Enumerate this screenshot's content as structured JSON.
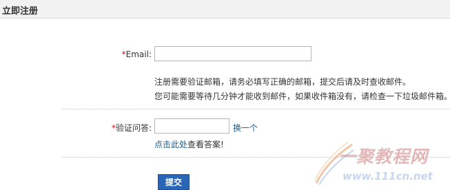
{
  "header": {
    "title": "立即注册"
  },
  "form": {
    "required_mark": "*",
    "email": {
      "label": "Email:",
      "value": "",
      "placeholder": ""
    },
    "hints": [
      "注册需要验证邮箱，请务必填写正确的邮箱，提交后请及时查收邮件。",
      "您可能需要等待几分钟才能收到邮件，如果收件箱没有，请检查一下垃圾邮件箱。"
    ],
    "question": {
      "label": "验证问答:",
      "value": "",
      "change_link": "换一个",
      "answer_link": "点击此处",
      "answer_rest": "查看答案!"
    },
    "submit_label": "提交"
  },
  "watermark": {
    "title": "一聚教程网",
    "url": "www.111cn.net"
  },
  "colors": {
    "required": "#e60000",
    "link": "#1a5b8c",
    "button": "#2a66b8",
    "header_bg": "#f2f2f2"
  }
}
